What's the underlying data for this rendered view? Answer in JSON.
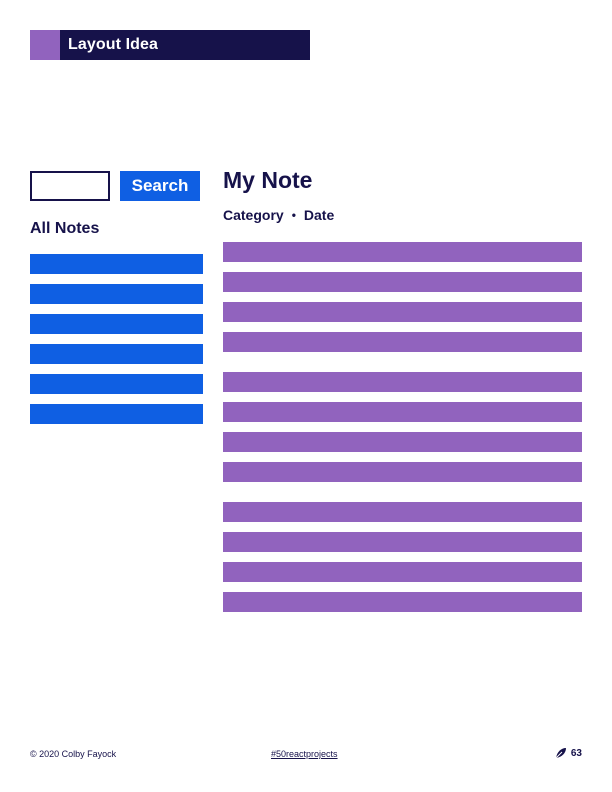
{
  "header": {
    "title": "Layout Idea"
  },
  "search": {
    "placeholder": "",
    "button_label": "Search"
  },
  "sidebar": {
    "title": "All Notes",
    "items": [
      "",
      "",
      "",
      "",
      "",
      ""
    ]
  },
  "note": {
    "title": "My Note",
    "category": "Category",
    "separator": "•",
    "date": "Date",
    "paragraphs": [
      4,
      4,
      4
    ]
  },
  "footer": {
    "copyright": "© 2020 Colby Fayock",
    "hashtag": "#50reactprojects",
    "page_number": "63"
  },
  "colors": {
    "navy": "#16124a",
    "purple": "#9163be",
    "blue": "#0f5fe3"
  }
}
